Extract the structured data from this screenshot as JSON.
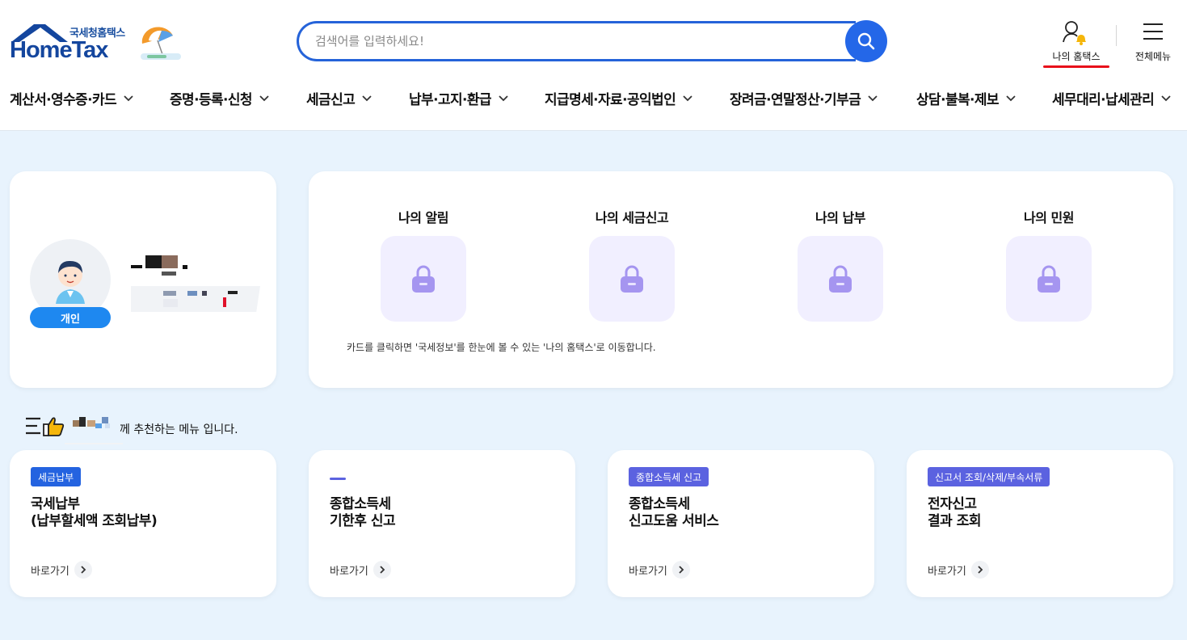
{
  "brand": {
    "sub_name": "국세청홈택스",
    "name": "HomeTax"
  },
  "search": {
    "placeholder": "검색어를 입력하세요!"
  },
  "header_actions": {
    "my_hometax": "나의 홈택스",
    "all_menu": "전체메뉴"
  },
  "gnb": [
    {
      "label": "계산서·영수증·카드"
    },
    {
      "label": "증명·등록·신청"
    },
    {
      "label": "세금신고"
    },
    {
      "label": "납부·고지·환급"
    },
    {
      "label": "지급명세·자료·공익법인"
    },
    {
      "label": "장려금·연말정산·기부금"
    },
    {
      "label": "상담·불복·제보"
    },
    {
      "label": "세무대리·납세관리"
    }
  ],
  "profile": {
    "user_type": "개인"
  },
  "my_cards": {
    "items": [
      {
        "label": "나의 알림"
      },
      {
        "label": "나의 세금신고"
      },
      {
        "label": "나의 납부"
      },
      {
        "label": "나의 민원"
      }
    ],
    "note": "카드를 클릭하면 '국세정보'를 한눈에 볼 수 있는 '나의 홈택스'로 이동합니다."
  },
  "recommend": {
    "text": "께 추천하는 메뉴 입니다."
  },
  "menu_cards": [
    {
      "tag": "세금납부",
      "tag_color": "#2463e0",
      "title": "국세납부\n(납부할세액 조회납부)",
      "go": "바로가기"
    },
    {
      "tag": "",
      "tag_color": "#5b62e0",
      "title": "종합소득세\n기한후 신고",
      "go": "바로가기"
    },
    {
      "tag": "종합소득세 신고",
      "tag_color": "#5b62e0",
      "title": "종합소득세\n신고도움 서비스",
      "go": "바로가기"
    },
    {
      "tag": "신고서 조회/삭제/부속서류",
      "tag_color": "#5b62e0",
      "title": "전자신고\n결과 조회",
      "go": "바로가기"
    }
  ],
  "colors": {
    "accent": "#2467e8",
    "page_bg": "#e8f3fd",
    "lock": "#a595f0",
    "underline": "#e8101a"
  }
}
